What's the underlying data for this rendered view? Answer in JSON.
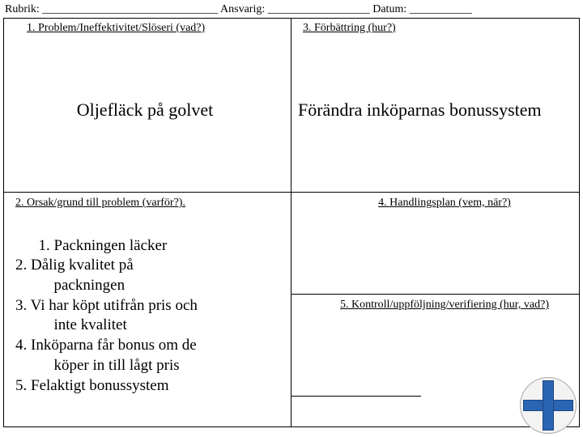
{
  "header": {
    "rubrik_label": "Rubrik:",
    "rubrik_blank": "_______________________________",
    "ansvarig_label": "Ansvarig:",
    "ansvarig_blank": "__________________",
    "datum_label": "Datum:",
    "datum_blank": "___________"
  },
  "left": {
    "h1": "1. Problem/Ineffektivitet/Slöseri (vad?)",
    "body1": "Oljefläck på golvet",
    "h2": "2. Orsak/grund till problem (varför?).",
    "body2": "1. Packningen läcker\n2. Dålig kvalitet på\n          packningen\n3. Vi har köpt utifrån pris och\n          inte kvalitet\n4. Inköparna får bonus om de\n          köper in till lågt pris\n5. Felaktigt bonussystem"
  },
  "right": {
    "h3": "3. Förbättring (hur?)",
    "body3": "Förändra inköparnas bonussystem",
    "h4": "4. Handlingsplan (vem, när?)",
    "h5": "5. Kontroll/uppföljning/verifiering (hur, vad?)"
  }
}
